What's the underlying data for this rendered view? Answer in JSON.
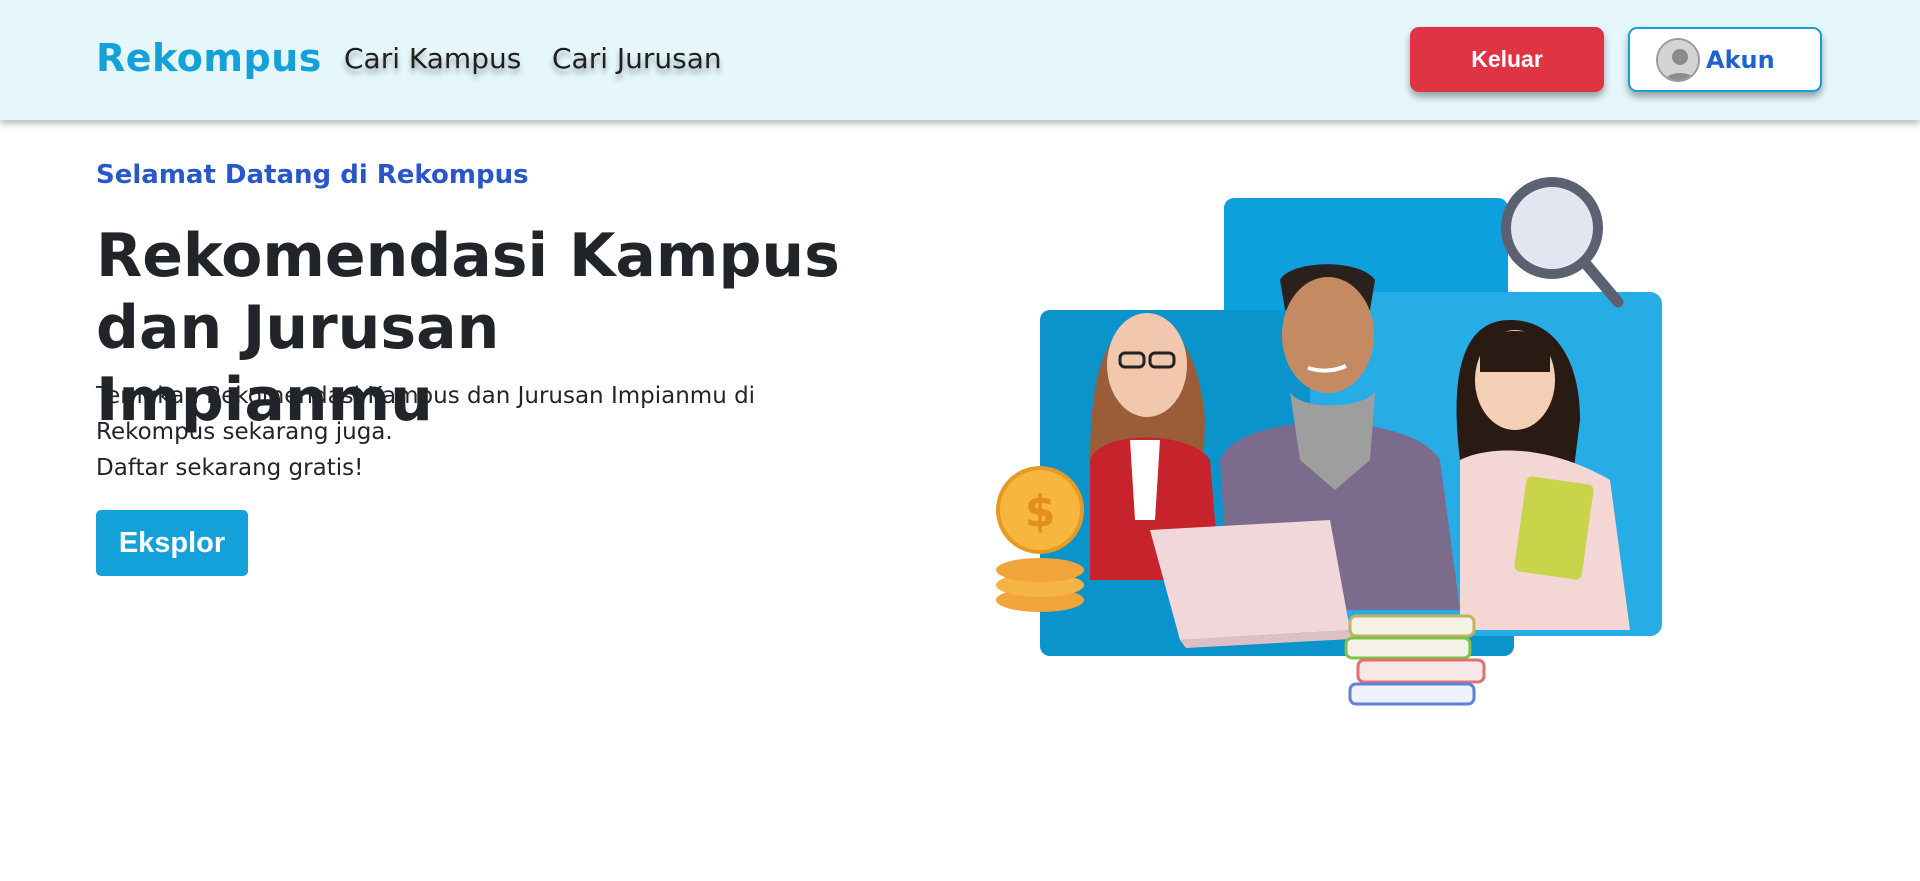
{
  "navbar": {
    "brand": "Rekompus",
    "links": [
      {
        "label": "Cari Kampus"
      },
      {
        "label": "Cari Jurusan"
      }
    ],
    "logout_label": "Keluar",
    "account_label": "Akun"
  },
  "hero": {
    "eyebrow": "Selamat Datang di Rekompus",
    "title_line1": "Rekomendasi Kampus",
    "title_line2": "dan Jurusan Impianmu",
    "desc_line1": "Temukan Rekomendasi Kampus dan Jurusan Impianmu di",
    "desc_line2": "Rekompus sekarang juga.",
    "desc_line3": "Daftar sekarang gratis!",
    "explore_label": "Eksplor"
  },
  "illustration": {
    "coin_symbol": "$"
  },
  "colors": {
    "brand": "#14a0d9",
    "navbar_bg": "#e6f7fb",
    "logout": "#de3444",
    "eyebrow": "#2757c8",
    "account_text": "#1e63c9"
  }
}
